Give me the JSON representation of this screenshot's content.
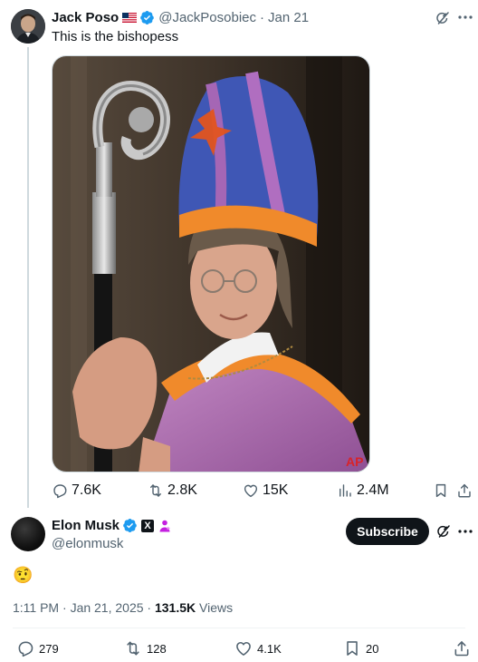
{
  "parent_tweet": {
    "author_name": "Jack Poso",
    "author_handle": "@JackPosobiec",
    "separator": "·",
    "date": "Jan 21",
    "text": "This is the bishopess",
    "image_watermark": "AP",
    "stats": {
      "replies": "7.6K",
      "reposts": "2.8K",
      "likes": "15K",
      "views": "2.4M"
    }
  },
  "main_tweet": {
    "author_name": "Elon Musk",
    "author_handle": "@elonmusk",
    "x_badge": "X",
    "subscribe_label": "Subscribe",
    "text": "🤨",
    "time": "1:11 PM",
    "date": "Jan 21, 2025",
    "separator": "·",
    "views_count": "131.5K",
    "views_label": "Views",
    "stats": {
      "replies": "279",
      "reposts": "128",
      "likes": "4.1K",
      "bookmarks": "20"
    }
  },
  "colors": {
    "text_primary": "#0f1419",
    "text_secondary": "#536471",
    "verified_blue": "#1d9bf0",
    "thread_line": "#cfd9de",
    "divider": "#eff3f4",
    "subscribe_bg": "#0f1419"
  },
  "icons": [
    "verified-badge-icon",
    "us-flag-icon",
    "grok-icon",
    "more-icon",
    "reply-icon",
    "repost-icon",
    "like-icon",
    "views-icon",
    "bookmark-icon",
    "share-icon"
  ]
}
